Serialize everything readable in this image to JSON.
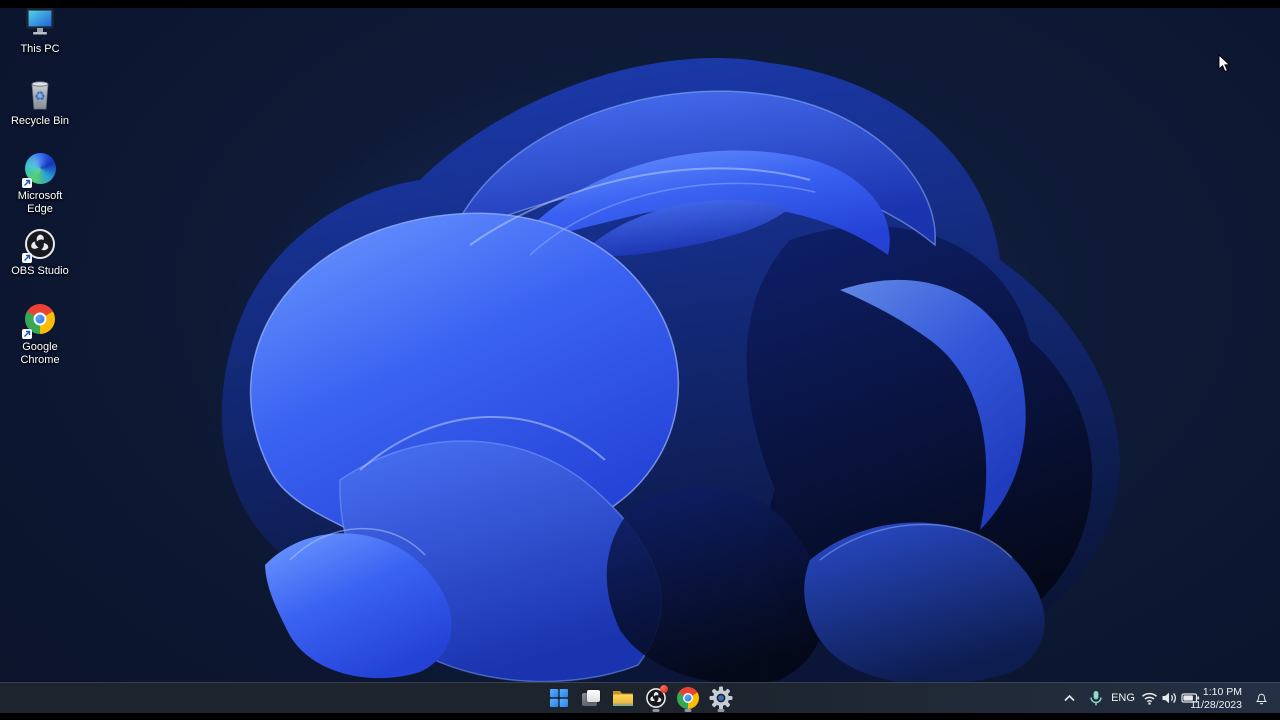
{
  "desktop": {
    "icons": [
      {
        "id": "this-pc",
        "label": "This PC",
        "shortcut": false
      },
      {
        "id": "recycle-bin",
        "label": "Recycle Bin",
        "shortcut": false
      },
      {
        "id": "microsoft-edge",
        "label": "Microsoft Edge",
        "shortcut": true
      },
      {
        "id": "obs-studio",
        "label": "OBS Studio",
        "shortcut": true
      },
      {
        "id": "google-chrome",
        "label": "Google Chrome",
        "shortcut": true
      }
    ]
  },
  "taskbar": {
    "items": [
      {
        "id": "start",
        "icon": "windows-start-icon",
        "running": false
      },
      {
        "id": "task-view",
        "icon": "task-view-icon",
        "running": false
      },
      {
        "id": "file-explorer",
        "icon": "folder-icon",
        "running": false
      },
      {
        "id": "obs-studio",
        "icon": "obs-icon",
        "running": true,
        "badge": "recording-dot"
      },
      {
        "id": "chrome",
        "icon": "chrome-icon",
        "running": true
      },
      {
        "id": "settings",
        "icon": "gear-icon",
        "running": true
      }
    ]
  },
  "tray": {
    "language": "ENG",
    "time": "1:10 PM",
    "date": "11/28/2023",
    "icons": [
      "chevron-up-icon",
      "microphone-icon",
      "wifi-icon",
      "volume-icon",
      "battery-icon",
      "bell-icon"
    ]
  },
  "colors": {
    "wallpaper_deep": "#070e1c",
    "bloom_bright": "#3f6ef5",
    "bloom_highlight": "#9db9ff",
    "taskbar_bg": "#1d242e",
    "start_blue": "#3f97ef",
    "recording_red": "#d81f12"
  }
}
